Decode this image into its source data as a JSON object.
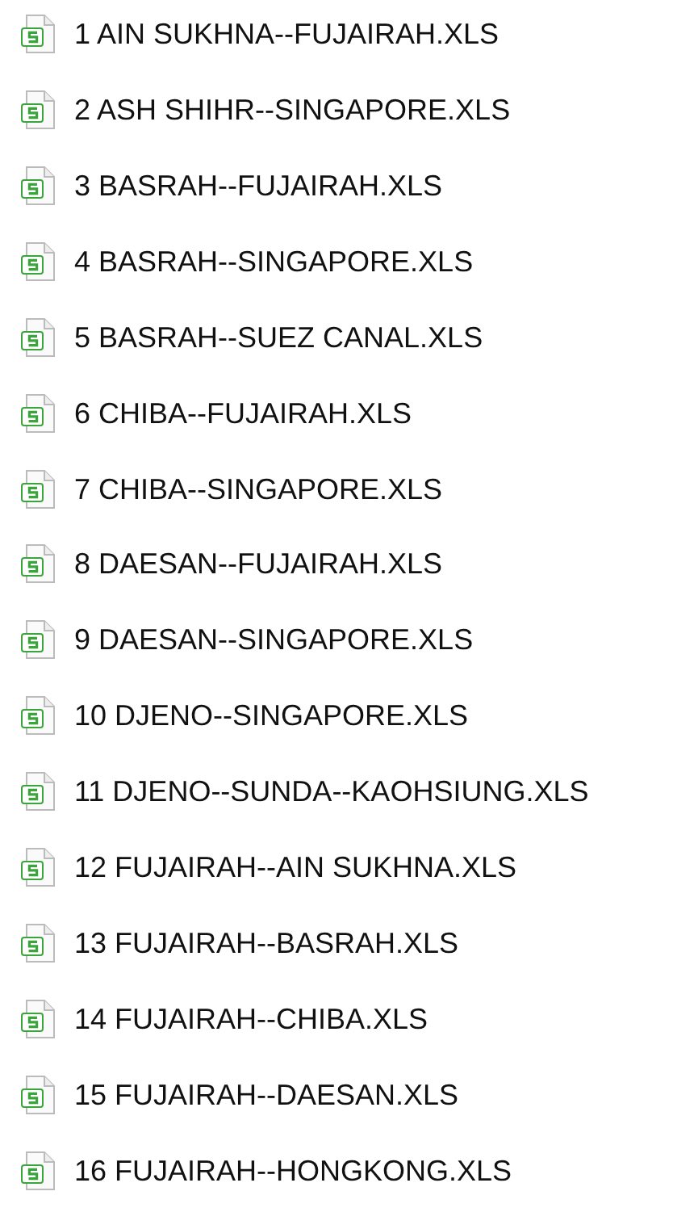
{
  "files": [
    {
      "name": "1 AIN SUKHNA--FUJAIRAH.XLS"
    },
    {
      "name": "2 ASH SHIHR--SINGAPORE.XLS"
    },
    {
      "name": "3 BASRAH--FUJAIRAH.XLS"
    },
    {
      "name": "4 BASRAH--SINGAPORE.XLS"
    },
    {
      "name": "5 BASRAH--SUEZ CANAL.XLS"
    },
    {
      "name": "6 CHIBA--FUJAIRAH.XLS"
    },
    {
      "name": "7 CHIBA--SINGAPORE.XLS"
    },
    {
      "name": "8 DAESAN--FUJAIRAH.XLS"
    },
    {
      "name": "9 DAESAN--SINGAPORE.XLS"
    },
    {
      "name": "10 DJENO--SINGAPORE.XLS"
    },
    {
      "name": "11 DJENO--SUNDA--KAOHSIUNG.XLS"
    },
    {
      "name": "12 FUJAIRAH--AIN SUKHNA.XLS"
    },
    {
      "name": "13 FUJAIRAH--BASRAH.XLS"
    },
    {
      "name": "14 FUJAIRAH--CHIBA.XLS"
    },
    {
      "name": "15 FUJAIRAH--DAESAN.XLS"
    },
    {
      "name": "16 FUJAIRAH--HONGKONG.XLS"
    }
  ]
}
